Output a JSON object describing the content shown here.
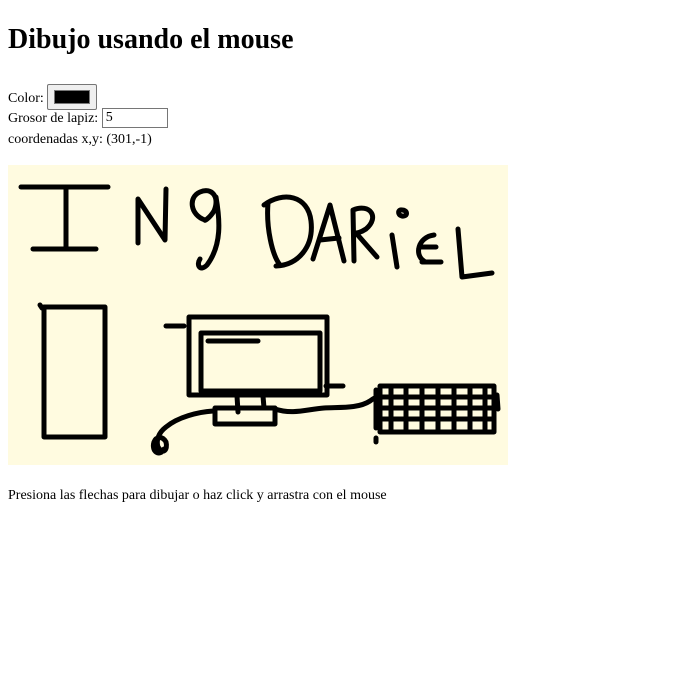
{
  "title": "Dibujo usando el mouse",
  "controls": {
    "color_label": "Color:",
    "color_value": "#000000",
    "thickness_label": "Grosor de lapiz:",
    "thickness_value": "5",
    "coords_label": "coordenadas x,y:",
    "coords_value": "(301,-1)"
  },
  "canvas": {
    "background": "#fffbe0",
    "stroke_color": "#000000"
  },
  "instructions": "Presiona las flechas para dibujar o haz click y arrastra con el mouse"
}
